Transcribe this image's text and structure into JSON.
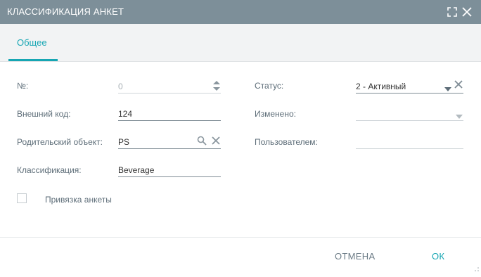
{
  "dialog": {
    "title": "КЛАССИФИКАЦИЯ АНКЕТ",
    "maximize_icon": "maximize-icon",
    "close_icon": "close-icon"
  },
  "tabs": [
    {
      "label": "Общее",
      "active": true
    }
  ],
  "form": {
    "number": {
      "label": "№:",
      "value": "0"
    },
    "external_code": {
      "label": "Внешний код:",
      "value": "124"
    },
    "parent_object": {
      "label": "Родительский объект:",
      "value": "PS"
    },
    "classification": {
      "label": "Классификация:",
      "value": "Beverage"
    },
    "status": {
      "label": "Статус:",
      "value": "2 - Активный"
    },
    "changed": {
      "label": "Изменено:",
      "value": ""
    },
    "by_user": {
      "label": "Пользователем:",
      "value": ""
    },
    "bind_survey": {
      "label": "Привязка анкеты",
      "checked": false
    }
  },
  "buttons": {
    "cancel": "ОТМЕНА",
    "ok": "ОК"
  },
  "colors": {
    "titlebar": "#7d8f99",
    "accent": "#17a6b3",
    "label": "#5d6d78"
  }
}
